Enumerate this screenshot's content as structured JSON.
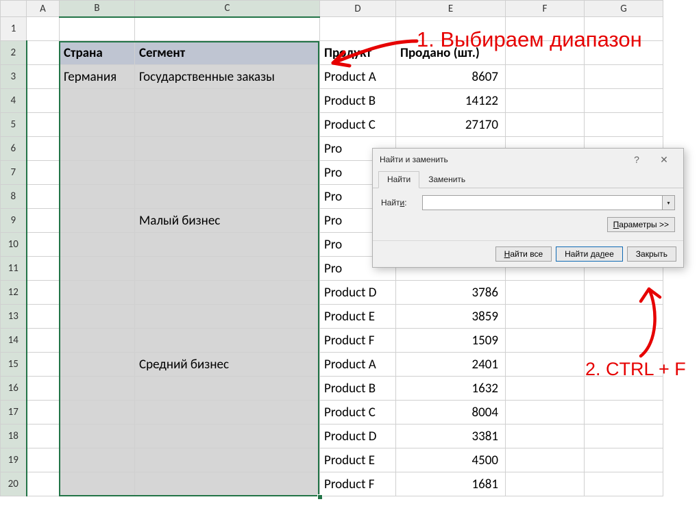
{
  "columns": [
    "A",
    "B",
    "C",
    "D",
    "E",
    "F",
    "G"
  ],
  "rows_count": 20,
  "header": {
    "B": "Страна",
    "C": "Сегмент",
    "D": "Продукт",
    "E": "Продано (шт.)"
  },
  "data": [
    {
      "B": "Германия",
      "C": "Государственные заказы",
      "D": "Product A",
      "E": "8607"
    },
    {
      "B": "",
      "C": "",
      "D": "Product B",
      "E": "14122"
    },
    {
      "B": "",
      "C": "",
      "D": "Product C",
      "E": "27170"
    },
    {
      "B": "",
      "C": "",
      "D": "Pro",
      "E": ""
    },
    {
      "B": "",
      "C": "",
      "D": "Pro",
      "E": ""
    },
    {
      "B": "",
      "C": "",
      "D": "Pro",
      "E": ""
    },
    {
      "B": "",
      "C": "Малый бизнес",
      "D": "Pro",
      "E": ""
    },
    {
      "B": "",
      "C": "",
      "D": "Pro",
      "E": ""
    },
    {
      "B": "",
      "C": "",
      "D": "Pro",
      "E": ""
    },
    {
      "B": "",
      "C": "",
      "D": "Product D",
      "E": "3786"
    },
    {
      "B": "",
      "C": "",
      "D": "Product E",
      "E": "3859"
    },
    {
      "B": "",
      "C": "",
      "D": "Product F",
      "E": "1509"
    },
    {
      "B": "",
      "C": "Средний бизнес",
      "D": "Product A",
      "E": "2401"
    },
    {
      "B": "",
      "C": "",
      "D": "Product B",
      "E": "1632"
    },
    {
      "B": "",
      "C": "",
      "D": "Product C",
      "E": "8004"
    },
    {
      "B": "",
      "C": "",
      "D": "Product D",
      "E": "3381"
    },
    {
      "B": "",
      "C": "",
      "D": "Product E",
      "E": "4500"
    },
    {
      "B": "",
      "C": "",
      "D": "Product F",
      "E": "1681"
    }
  ],
  "dialog": {
    "title": "Найти и заменить",
    "tab_find": "Найти",
    "tab_replace": "Заменить",
    "label_find": "Найти:",
    "input_value": "",
    "btn_options": "Параметры >>",
    "btn_find_all": "Найти все",
    "btn_find_next": "Найти далее",
    "btn_close": "Закрыть",
    "help": "?",
    "close_x": "✕"
  },
  "annotations": {
    "a1": "1. Выбираем диапазон",
    "a2": "2. CTRL + F"
  }
}
